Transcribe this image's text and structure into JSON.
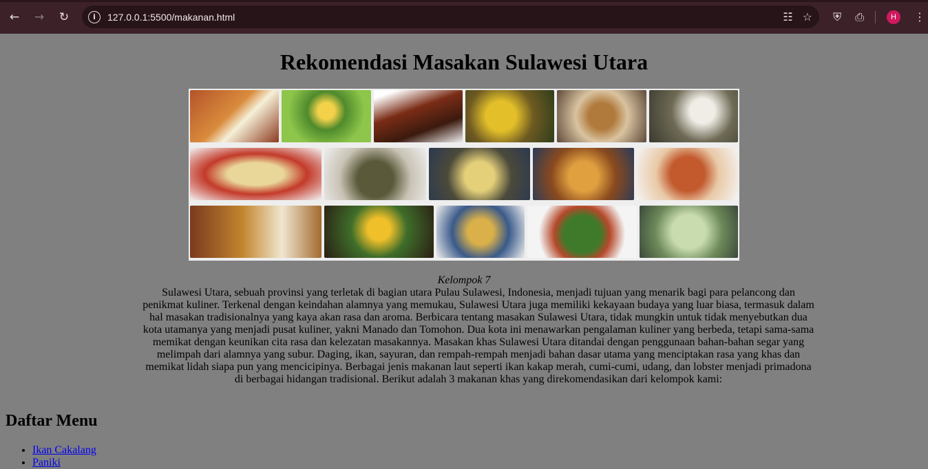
{
  "browser": {
    "url": "127.0.0.1:5500/makanan.html",
    "avatar_letter": "H",
    "icons": [
      "back-icon",
      "forward-icon",
      "reload-icon",
      "info-icon",
      "translate-icon",
      "star-icon",
      "shield-icon",
      "extensions-icon",
      "menu-icon"
    ]
  },
  "page": {
    "title": "Rekomendasi Masakan Sulawesi Utara",
    "caption": "Kelompok 7",
    "paragraph": "Sulawesi Utara, sebuah provinsi yang terletak di bagian utara Pulau Sulawesi, Indonesia, menjadi tujuan yang menarik bagi para pelancong dan penikmat kuliner. Terkenal dengan keindahan alamnya yang memukau, Sulawesi Utara juga memiliki kekayaan budaya yang luar biasa, termasuk dalam hal masakan tradisionalnya yang kaya akan rasa dan aroma. Berbicara tentang masakan Sulawesi Utara, tidak mungkin untuk tidak menyebutkan dua kota utamanya yang menjadi pusat kuliner, yakni Manado dan Tomohon. Dua kota ini menawarkan pengalaman kuliner yang berbeda, tetapi sama-sama memikat dengan keunikan cita rasa dan kelezatan masakannya. Masakan khas Sulawesi Utara ditandai dengan penggunaan bahan-bahan segar yang melimpah dari alamnya yang subur. Daging, ikan, sayuran, dan rempah-rempah menjadi bahan dasar utama yang menciptakan rasa yang khas dan memikat lidah siapa pun yang mencicipinya. Berbagai jenis makanan laut seperti ikan kakap merah, cumi-cumi, udang, dan lobster menjadi primadona di berbagai hidangan tradisional. Berikut adalah 3 makanan khas yang direkomendasikan dari kelompok kami:",
    "menu_heading": "Daftar Menu",
    "menu_items": [
      "Ikan Cakalang",
      "Paniki"
    ]
  }
}
